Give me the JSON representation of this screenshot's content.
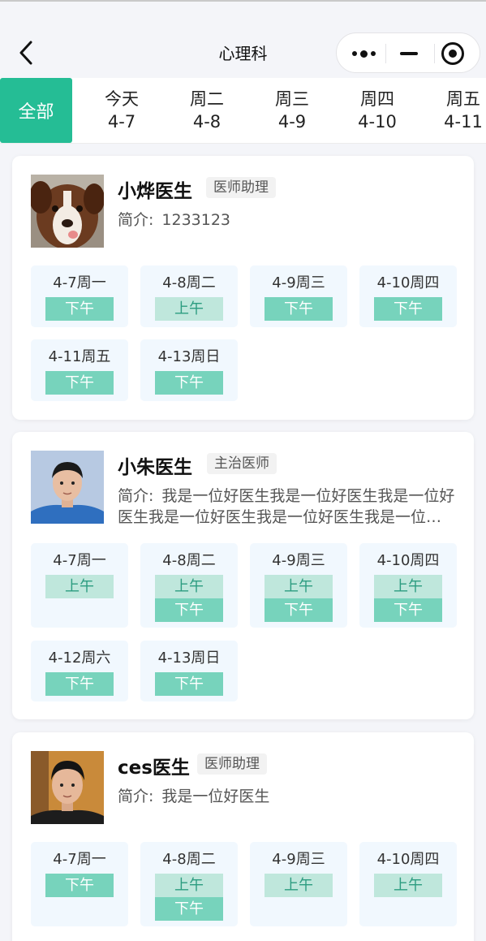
{
  "header": {
    "title": "心理科"
  },
  "tabs": {
    "all_label": "全部",
    "days": [
      {
        "week": "今天",
        "date": "4-7"
      },
      {
        "week": "周二",
        "date": "4-8"
      },
      {
        "week": "周三",
        "date": "4-9"
      },
      {
        "week": "周四",
        "date": "4-10"
      },
      {
        "week": "周五",
        "date": "4-11"
      }
    ]
  },
  "doctors": [
    {
      "name": "小烨医生",
      "title": "医师助理",
      "intro_label": "简介:",
      "intro": "1233123",
      "avatar": "dog-photo",
      "slots": [
        {
          "date": "4-7周一",
          "periods": [
            "下午"
          ]
        },
        {
          "date": "4-8周二",
          "periods": [
            "上午"
          ]
        },
        {
          "date": "4-9周三",
          "periods": [
            "下午"
          ]
        },
        {
          "date": "4-10周四",
          "periods": [
            "下午"
          ]
        },
        {
          "date": "4-11周五",
          "periods": [
            "下午"
          ]
        },
        {
          "date": "4-13周日",
          "periods": [
            "下午"
          ]
        }
      ]
    },
    {
      "name": "小朱医生",
      "title": "主治医师",
      "intro_label": "简介:",
      "intro": "我是一位好医生我是一位好医生我是一位好医生我是一位好医生我是一位好医生我是一位好医生",
      "avatar": "person-photo-blue",
      "slots": [
        {
          "date": "4-7周一",
          "periods": [
            "上午"
          ]
        },
        {
          "date": "4-8周二",
          "periods": [
            "上午",
            "下午"
          ]
        },
        {
          "date": "4-9周三",
          "periods": [
            "上午",
            "下午"
          ]
        },
        {
          "date": "4-10周四",
          "periods": [
            "上午",
            "下午"
          ]
        },
        {
          "date": "4-12周六",
          "periods": [
            "下午"
          ]
        },
        {
          "date": "4-13周日",
          "periods": [
            "下午"
          ]
        }
      ]
    },
    {
      "name": "ces医生",
      "title": "医师助理",
      "intro_label": "简介:",
      "intro": "我是一位好医生",
      "avatar": "person-photo-orange",
      "slots": [
        {
          "date": "4-7周一",
          "periods": [
            "下午"
          ]
        },
        {
          "date": "4-8周二",
          "periods": [
            "上午",
            "下午"
          ]
        },
        {
          "date": "4-9周三",
          "periods": [
            "上午"
          ]
        },
        {
          "date": "4-10周四",
          "periods": [
            "上午"
          ]
        }
      ]
    }
  ],
  "colors": {
    "accent": "#25bd95",
    "am_bg": "#bfe7dc",
    "pm_bg": "#77d3bc",
    "slot_bg": "#f1f8fe",
    "page_bg": "#f4f5f9"
  }
}
